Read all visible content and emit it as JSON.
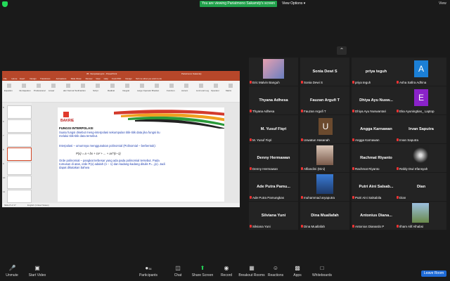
{
  "topbar": {
    "banner": "You are viewing Pariatmono Sakamdy's screen",
    "view_options": "View Options ▾",
    "view_label": "View"
  },
  "shared_screen": {
    "title": "05. Interpolasi.pptx - PowerPoint",
    "user": "Pariatmono Sakamdy",
    "tabs": [
      "File",
      "Home",
      "Insert",
      "Design",
      "Transitions",
      "Animations",
      "Slide Show",
      "Review",
      "View",
      "Help",
      "Foxit PDF",
      "Design",
      "Tell me what you want to do"
    ],
    "ribbon_items": [
      "Equation",
      "Ink Equation",
      "Professional",
      "Linear",
      "abc Normal Text",
      "Fraction",
      "Script",
      "Radical",
      "Integral",
      "Large Operator",
      "Bracket",
      "Function",
      "Accent",
      "Limit and Log",
      "Operator",
      "Matrix"
    ],
    "thumbs": [
      "5",
      "6",
      "7",
      "8",
      "9",
      "10",
      "11"
    ],
    "slide": {
      "logo": "BAKRIE",
      "heading": "FUNGSI INTERPOLASI",
      "p1": "Suatu fungsi disebut meng-interpolasi sekumpulan titik-titik data jika fungsi itu melalui titik-titik data tersebut.",
      "p2": "Interpolasi – umumnya menggunakan polinomial (Polinomial – berbentuk):",
      "formula1": "P(x) = a + bx + cx² + ... + ax^(n−1)",
      "p3": "Orde polinomial – pangkat terbesar yang ada pada polinomial tersebut. Pada rumusan di atas, orde P(x) adalah (n − 1) dan kadang-kadang ditulis Pₙ₋₁(x). Jadi dapat dikatakan bahwa"
    },
    "status_left": "Slide 8 of 17",
    "status_mid": "English (United States)"
  },
  "participants": [
    {
      "name": "",
      "label": "Eric Malvin Banguh",
      "photo": "sunset"
    },
    {
      "name": "Sonia Dewi S",
      "label": "Sonia Dewi S"
    },
    {
      "name": "priya teguh",
      "label": "priya teguh"
    },
    {
      "name": "A",
      "label": "Asha Safira Adhina",
      "avatar_color": "#1b7fd6"
    },
    {
      "name": "Thyana Adhesa",
      "label": "Thyana Adhesa"
    },
    {
      "name": "Fauzan Argufi T",
      "label": "Fauzan Argufi T"
    },
    {
      "name": "Dhiya Ayu Nusw...",
      "label": "Dhiya Ayu Nuswantari"
    },
    {
      "name": "E",
      "label": "Eka Ayuningtias_ Laptop",
      "avatar_color": "#8a22c9"
    },
    {
      "name": "M. Yusuf Fiqri",
      "label": "M. Yusuf Fiqri"
    },
    {
      "name": "U",
      "label": "Uswatun Hasanah",
      "avatar_color": "#6b4a2e"
    },
    {
      "name": "Angga Karnawan",
      "label": "Angga Karnawan"
    },
    {
      "name": "Irvan Saputra",
      "label": "Irvan Saputra"
    },
    {
      "name": "Denny Hermawan",
      "label": "Denny Hermawan"
    },
    {
      "name": "",
      "label": "Alfiandini (Dini)",
      "photo": "girl"
    },
    {
      "name": "Rachmat Riyanto",
      "label": "Rachmat Riyanto"
    },
    {
      "name": "",
      "label": "Rafdy Dwi Irfansyah",
      "photo": "emblem"
    },
    {
      "name": "Ade Putra Pamu...",
      "label": "Ade Putra Pamungkas"
    },
    {
      "name": "",
      "label": "muhammad aryaputra",
      "photo": "person"
    },
    {
      "name": "Putri Aini Salsab...",
      "label": "Putri Aini Salsabila"
    },
    {
      "name": "Dian",
      "label": "Dian"
    },
    {
      "name": "Silviana Yuni",
      "label": "Silviana Yuni"
    },
    {
      "name": "Dina Muallafah",
      "label": "Dina Muallafah"
    },
    {
      "name": "Antonius Diana...",
      "label": "Antonius Dianardo P"
    },
    {
      "name": "",
      "label": "Ilham Alif Alhabsi",
      "photo": "outdoor"
    }
  ],
  "toolbar": {
    "unmute": "Unmute",
    "start_video": "Start Video",
    "participants": "Participants",
    "participants_count": "34",
    "chat": "Chat",
    "share_screen": "Share Screen",
    "record": "Record",
    "breakout": "Breakout Rooms",
    "reactions": "Reactions",
    "apps": "Apps",
    "whiteboards": "Whiteboards",
    "leave": "Leave Room"
  },
  "colors": {
    "share_green": "#23d959",
    "leave_blue": "#1e6ad6",
    "ppt_red": "#b7472a"
  }
}
